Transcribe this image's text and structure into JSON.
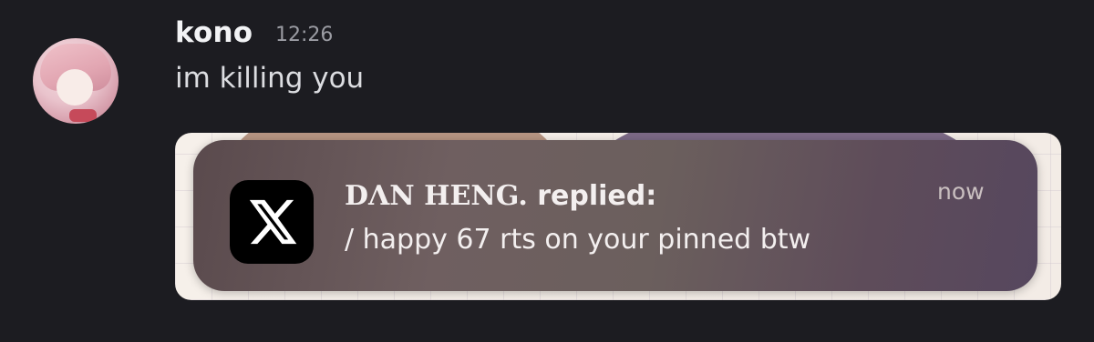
{
  "message": {
    "username": "kono",
    "timestamp": "12:26",
    "text": "im killing you"
  },
  "notification": {
    "app_icon": "x-logo-icon",
    "sender_name": "DΛN HENG.",
    "action": " replied:",
    "body": "/ happy 67 rts on your pinned btw",
    "time": "now"
  },
  "colors": {
    "background": "#1c1c21",
    "username": "#f2f3f5",
    "timestamp": "#9b9ca3",
    "message_text": "#dcdde1",
    "notification_text": "#f3efef"
  }
}
